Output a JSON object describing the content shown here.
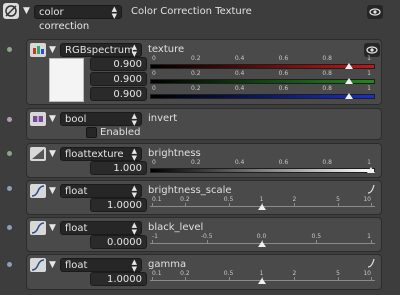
{
  "header": {
    "node_type": "color correction",
    "node_name": "Color Correction Texture"
  },
  "texture": {
    "type": "RGBspectrum",
    "label": "texture",
    "values": [
      "0.900",
      "0.900",
      "0.900"
    ],
    "scale": [
      "0",
      "0.2",
      "0.4",
      "0.6",
      "0.8",
      "1"
    ],
    "channel_values": [
      0.9,
      0.9,
      0.9
    ],
    "colors": {
      "r": "#c01818",
      "g": "#1f8a1f",
      "b": "#1830c8"
    }
  },
  "invert": {
    "type": "bool",
    "label": "invert",
    "checkbox_label": "Enabled"
  },
  "brightness": {
    "type": "floattexture",
    "label": "brightness",
    "value": "1.000",
    "scale": [
      "0",
      "0.2",
      "0.4",
      "0.6",
      "0.8",
      "1"
    ],
    "level": 1.0
  },
  "brightness_scale": {
    "type": "float",
    "label": "brightness_scale",
    "value": "1.0000",
    "scale": [
      "0.1",
      "0.2",
      "0.5",
      "1",
      "2",
      "5",
      "10"
    ],
    "level": 1
  },
  "black_level": {
    "type": "float",
    "label": "black_level",
    "value": "0.0000",
    "scale": [
      "-1",
      "-0.5",
      "0.0",
      "0.5",
      "1"
    ],
    "level": 0
  },
  "gamma": {
    "type": "float",
    "label": "gamma",
    "value": "1.0000",
    "scale": [
      "0.1",
      "0.2",
      "0.5",
      "1",
      "2",
      "5",
      "10"
    ],
    "level": 1
  }
}
